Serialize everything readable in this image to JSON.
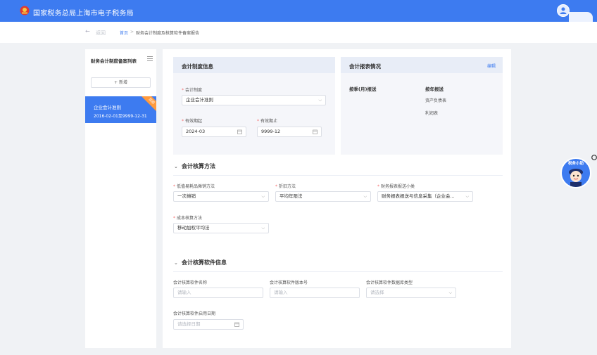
{
  "header": {
    "title": "国家税务总局上海市电子税务局"
  },
  "breadcrumb": {
    "back_label": "返回",
    "home": "首页",
    "separator": ">",
    "current": "财务会计制度及核算软件备案报告"
  },
  "sidebar": {
    "title": "财务会计制度备案列表",
    "add_button": "+ 新增",
    "items": [
      {
        "name": "企业会计准则",
        "date_range": "2016-02-01至9999-12-31",
        "badge": "当前"
      }
    ]
  },
  "accounting_system": {
    "title": "会计制度信息",
    "system_label": "会计制度",
    "system_value": "企业会计准则",
    "start_label": "有效期起",
    "start_value": "2024-03",
    "end_label": "有效期止",
    "end_value": "9999-12"
  },
  "reports": {
    "title": "会计报表情况",
    "edit": "编辑",
    "monthly_label": "按季(月)报送",
    "annual_label": "按年报送",
    "annual_items": [
      "资产负债表",
      "利润表"
    ]
  },
  "method": {
    "title": "会计核算方法",
    "lowvalue_label": "低值易耗品摊销方法",
    "lowvalue_value": "一次摊销",
    "depreciation_label": "折旧方法",
    "depreciation_value": "平均年限法",
    "report_cat_label": "财务报表报送小类",
    "report_cat_value": "财务报表报送与信息采集（企业会...",
    "cost_label": "成本核算方法",
    "cost_value": "移动加权平均法"
  },
  "software": {
    "title": "会计核算软件信息",
    "name_label": "会计核算软件名称",
    "name_placeholder": "请输入",
    "version_label": "会计核算软件版本号",
    "version_placeholder": "请输入",
    "db_label": "会计核算软件数据库类型",
    "db_placeholder": "请选择",
    "date_label": "会计核算软件启用日期",
    "date_placeholder": "请选择日期"
  },
  "assistant": {
    "label": "税务小助"
  },
  "colors": {
    "primary": "#3d7bf0",
    "required": "#f56c6c",
    "badge": "#ff9a3d"
  }
}
